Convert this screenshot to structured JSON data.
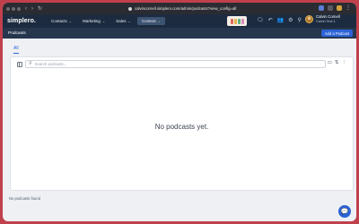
{
  "browser": {
    "url": "calvincornell.simplero.com/admin/podcasts?view_config=all",
    "nav_controls": [
      "‹",
      "›",
      "↻"
    ],
    "menu_icon": "⋮"
  },
  "app": {
    "logo": "simplero.",
    "nav": [
      {
        "label": "Contacts",
        "chevron": "⌄"
      },
      {
        "label": "Marketing",
        "chevron": "⌄"
      },
      {
        "label": "Sales",
        "chevron": "⌄"
      },
      {
        "label": "Content",
        "chevron": "⌄"
      }
    ],
    "tools": [
      "🗨",
      "↶",
      "👥",
      "⚙",
      "⚲"
    ],
    "user": {
      "name": "Calvin Cornell",
      "subtitle": "Calvin Test 1"
    }
  },
  "subheader": {
    "title": "Podcasts",
    "add_button": "Add a Podcast"
  },
  "tabs": [
    {
      "label": "All",
      "active": true
    }
  ],
  "search": {
    "placeholder": "Search podcasts...",
    "value": ""
  },
  "panel_tools": [
    "▭",
    "⇅",
    "⋮"
  ],
  "empty_message": "No podcasts yet.",
  "status_text": "No podcasts found",
  "help_icon": "💬",
  "colors": {
    "accent": "#2c63d6",
    "header_bg": "#1c2b3f",
    "subheader_bg": "#26374d",
    "window_border": "#c0404c"
  }
}
